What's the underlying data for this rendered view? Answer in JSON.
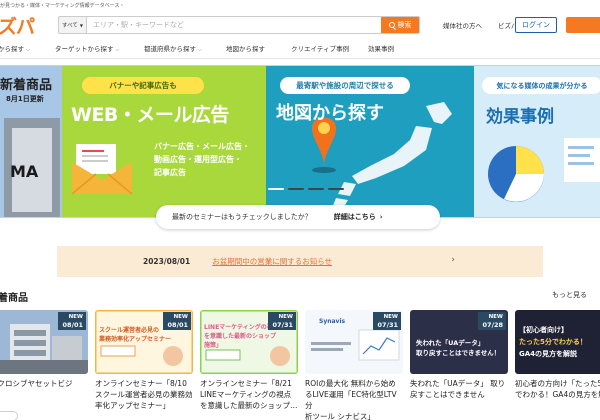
{
  "header": {
    "tagline": "が見つかる・媒体・マーケティング情報データベース・",
    "logo": "ズパ",
    "search": {
      "category": "すべて",
      "placeholder": "エリア・駅・キーワードなど",
      "button": "検索"
    },
    "links": [
      "媒体社の方へ",
      "ビズパとは"
    ],
    "login": "ログイン"
  },
  "nav": {
    "items": [
      {
        "label": "から探す",
        "caret": true
      },
      {
        "label": "ターゲットから探す",
        "caret": true
      },
      {
        "label": "都道府県から探す",
        "caret": true
      },
      {
        "label": "地図から探す",
        "caret": false
      },
      {
        "label": "クリエイティブ事例",
        "caret": false
      },
      {
        "label": "効果事例",
        "caret": false
      }
    ]
  },
  "banners": [
    {
      "title": "新着商品",
      "subtitle": "8月1日更新",
      "sign": "MA"
    },
    {
      "pill": "バナーや記事広告も",
      "title": "WEB・メール広告",
      "lines": [
        "バナー広告・メール広告・",
        "動画広告・運用型広告・",
        "記事広告"
      ]
    },
    {
      "pill": "最寄駅や施設の周辺で探せる",
      "title": "地図から探す"
    },
    {
      "pill": "気になる媒体の成果が分かる",
      "title": "効果事例"
    }
  ],
  "seminar_bar": {
    "question": "最新のセミナーはもうチェックしましたか？",
    "details": "詳細はこちら"
  },
  "notice": {
    "date": "2023/08/01",
    "text": "お盆期間中の営業に関するお知らせ"
  },
  "products": {
    "section_title": "着商品",
    "more": "もっと見る",
    "items": [
      {
        "badge": "NEW",
        "date": "08/01",
        "title": [
          "ンクロシブヤセットビジ",
          "ン"
        ]
      },
      {
        "badge": "NEW",
        "date": "08/01",
        "thumb_text": [
          "スクール運営者必見の",
          "業務効率化アップセミナー"
        ],
        "title": [
          "オンラインセミナー「8/10",
          "スクール運営者必見の業務効",
          "率化アップセミナー」"
        ]
      },
      {
        "badge": "NEW",
        "date": "07/31",
        "thumb_text": [
          "LINEマーケティングの視点",
          "を意識した最新のショップ",
          "施策」"
        ],
        "title": [
          "オンラインセミナー「8/21",
          "LINEマーケティングの視点",
          "を意識した最新のショップ…"
        ]
      },
      {
        "badge": "NEW",
        "date": "07/31",
        "brand": "Synavis",
        "title": [
          "ROIの最大化 無料から始め",
          "るLIVE運用「EC特化型LTV分",
          "析ツール シナビス」"
        ]
      },
      {
        "badge": "NEW",
        "date": "07/28",
        "thumb_text": [
          "失われた「UAデータ」",
          "取り戻すことはできません！"
        ],
        "title": [
          "失われた「UAデータ」 取り",
          "戻すことはできません"
        ]
      },
      {
        "thumb_text": [
          "【初心者向け】",
          "たった5分でわかる！",
          "GA4の見方を解説"
        ],
        "title": [
          "初心者の方向け「たった5分",
          "でわかる！GA4の見方を解"
        ]
      }
    ]
  }
}
